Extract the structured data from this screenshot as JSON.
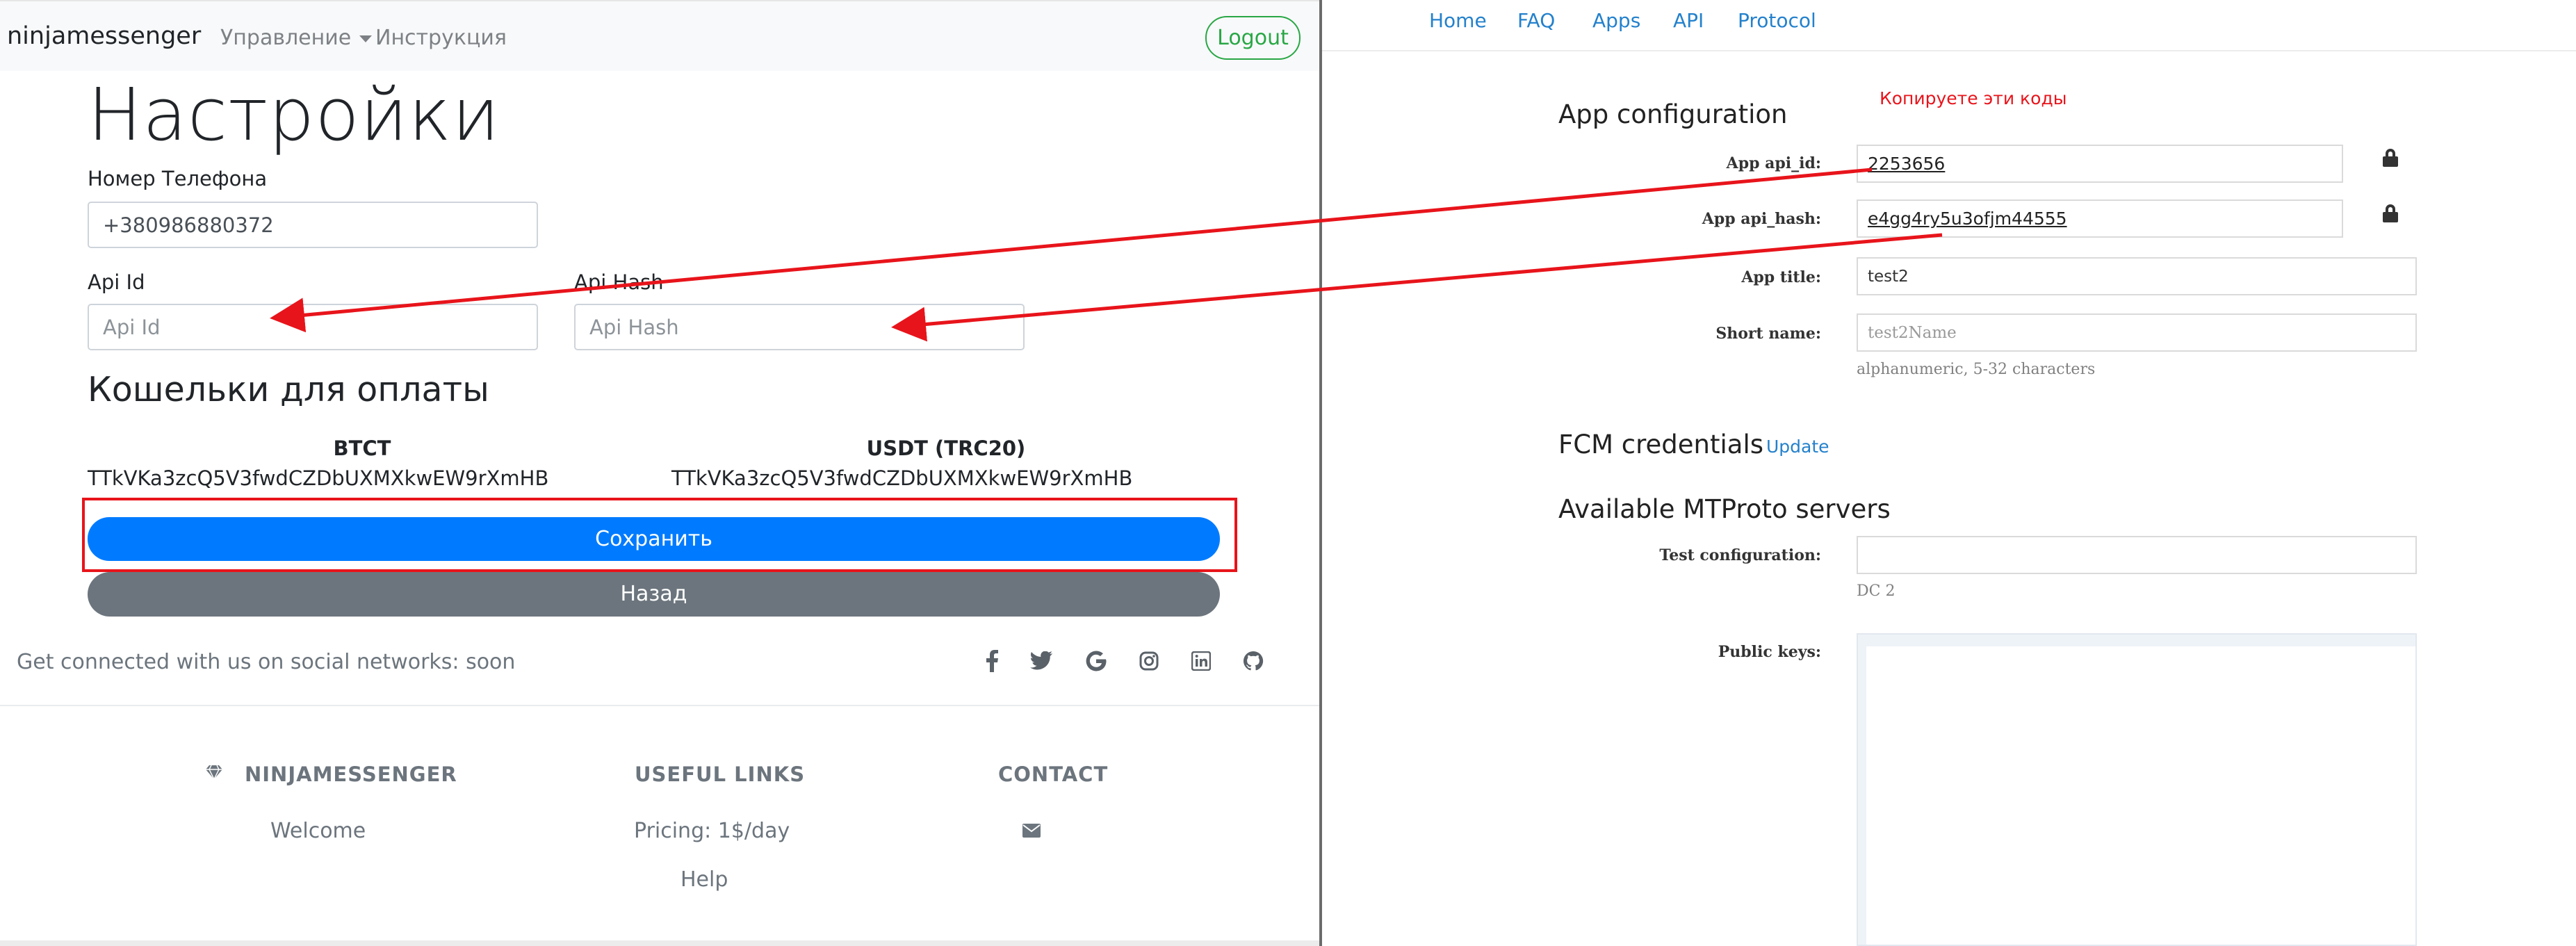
{
  "left": {
    "navbar": {
      "brand": "ninjamessenger",
      "menu_manage": "Управление",
      "menu_instructions": "Инструкция",
      "logout_label": "Logout"
    },
    "page_title": "Настройки",
    "phone": {
      "label": "Номер Телефона",
      "value": "+380986880372"
    },
    "api_id": {
      "label": "Api Id",
      "placeholder": "Api Id"
    },
    "api_hash": {
      "label": "Api Hash",
      "placeholder": "Api Hash"
    },
    "wallets_title": "Кошельки для оплаты",
    "wallets": [
      {
        "title": "BTCT",
        "address": "TTkVKa3zcQ5V3fwdCZDbUXMXkwEW9rXmHB"
      },
      {
        "title": "USDT (TRC20)",
        "address": "TTkVKa3zcQ5V3fwdCZDbUXMXkwEW9rXmHB"
      }
    ],
    "save_label": "Сохранить",
    "back_label": "Назад",
    "social_text": "Get connected with us on social networks: soon",
    "social_icons": [
      "facebook-icon",
      "twitter-icon",
      "google-icon",
      "instagram-icon",
      "linkedin-icon",
      "github-icon"
    ],
    "footer": {
      "col1_title": "NINJAMESSENGER",
      "col1_items": [
        "Welcome"
      ],
      "col2_title": "USEFUL LINKS",
      "col2_items": [
        "Pricing: 1$/day",
        "Help"
      ],
      "col3_title": "CONTACT",
      "col3_icon": "envelope-icon"
    },
    "colors": {
      "primary": "#007bff",
      "secondary": "#6c757d",
      "success": "#28a745",
      "highlight_red": "#e8141b"
    }
  },
  "right": {
    "nav": [
      "Home",
      "FAQ",
      "Apps",
      "API",
      "Protocol"
    ],
    "app_config_title": "App configuration",
    "copy_note": "Копируете эти коды",
    "fields": {
      "api_id": {
        "label": "App api_id:",
        "value": "2253656"
      },
      "api_hash": {
        "label": "App api_hash:",
        "value": "e4gg4ry5u3ofjm44555"
      },
      "app_title": {
        "label": "App title:",
        "value": "test2"
      },
      "short_name": {
        "label": "Short name:",
        "placeholder": "test2Name",
        "hint": "alphanumeric, 5-32 characters"
      }
    },
    "fcm_title": "FCM credentials",
    "fcm_update": "Update",
    "mtproto_title": "Available MTProto servers",
    "test_config": {
      "label": "Test configuration:",
      "hint": "DC 2"
    },
    "public_keys_label": "Public keys:",
    "colors": {
      "link": "#2481cc",
      "note_red": "#e8141b"
    }
  }
}
